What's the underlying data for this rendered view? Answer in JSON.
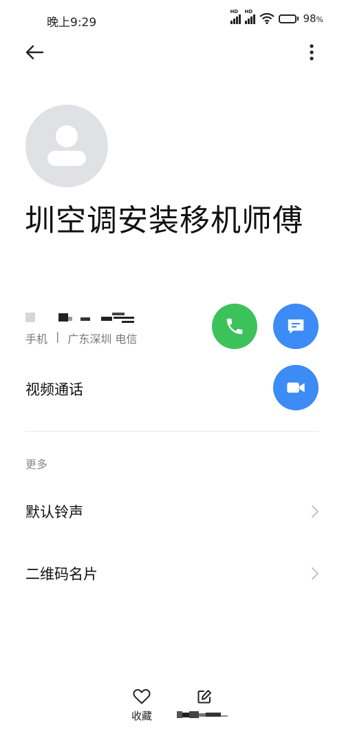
{
  "status_bar": {
    "time": "晚上9:29",
    "signal_badge": "HD",
    "battery_percent": "98",
    "battery_unit": "%",
    "battery_level": 0.98
  },
  "top_bar": {
    "back_icon": "arrow-left-icon",
    "more_icon": "more-vertical-icon"
  },
  "contact": {
    "name": "圳空调安装移机师傅",
    "avatar_icon": "person-placeholder-icon"
  },
  "phone": {
    "type": "手机",
    "separator": "|",
    "location": "广东深圳 电信",
    "call_icon": "phone-icon",
    "message_icon": "message-icon"
  },
  "video_call": {
    "label": "视频通话",
    "icon": "video-camera-icon"
  },
  "more_section": {
    "header": "更多",
    "items": [
      {
        "label": "默认铃声",
        "icon": "chevron-right-icon"
      },
      {
        "label": "二维码名片",
        "icon": "chevron-right-icon"
      }
    ]
  },
  "bottom_bar": {
    "favorite_label": "收藏",
    "favorite_icon": "heart-icon",
    "edit_icon": "edit-icon"
  },
  "colors": {
    "call_green": "#3cc25a",
    "action_blue": "#3d8bf5",
    "avatar_gray": "#dfe1e5",
    "secondary_text": "#777777"
  }
}
